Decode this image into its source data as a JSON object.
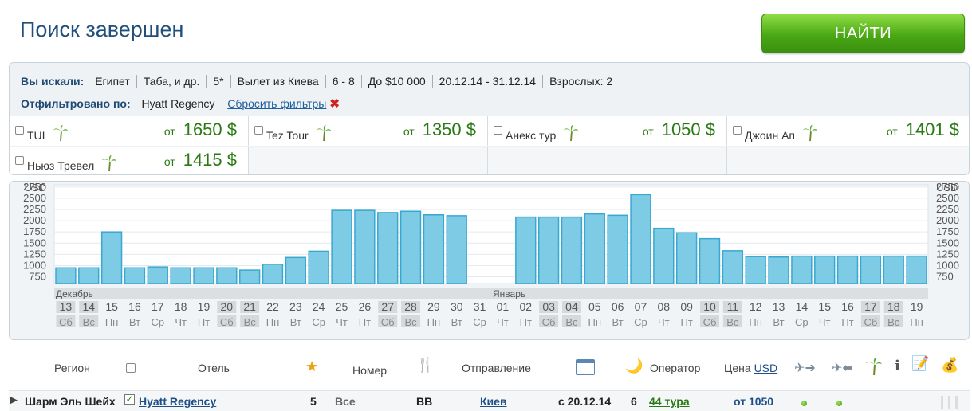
{
  "page_title": "Поиск завершен",
  "find_button": "НАЙТИ",
  "search": {
    "label": "Вы искали:",
    "criteria": [
      "Египет",
      "Таба, и др.",
      "5*",
      "Вылет из Киева",
      "6 - 8",
      "До $10 000",
      "20.12.14 - 31.12.14",
      "Взрослых: 2"
    ],
    "filter_label": "Отфильтровано по:",
    "filter_value": "Hyatt Regency",
    "reset_label": "Сбросить фильтры",
    "reset_icon": "✖"
  },
  "operators": [
    {
      "name": "TUI",
      "from": "от",
      "price": "1650 $"
    },
    {
      "name": "Tez Tour",
      "from": "от",
      "price": "1350 $"
    },
    {
      "name": "Анекс тур",
      "from": "от",
      "price": "1050 $"
    },
    {
      "name": "Джоин Ап",
      "from": "от",
      "price": "1401 $"
    },
    {
      "name": "Ньюз Тревел",
      "from": "от",
      "price": "1415 $"
    }
  ],
  "chart_data": {
    "type": "bar",
    "y_unit": "USD",
    "y_ticks": [
      750,
      1000,
      1250,
      1500,
      1750,
      2000,
      2250,
      2500,
      2750
    ],
    "ylim": [
      600,
      2800
    ],
    "months": [
      {
        "label": "Декабрь",
        "start_index": 0
      },
      {
        "label": "Январь",
        "start_index": 19
      }
    ],
    "days": [
      "13",
      "14",
      "15",
      "16",
      "17",
      "18",
      "19",
      "20",
      "21",
      "22",
      "23",
      "24",
      "25",
      "26",
      "27",
      "28",
      "29",
      "30",
      "31",
      "01",
      "02",
      "03",
      "04",
      "05",
      "06",
      "07",
      "08",
      "09",
      "10",
      "11",
      "12",
      "13",
      "14",
      "15",
      "16",
      "17",
      "18",
      "19"
    ],
    "weekdays": [
      "Сб",
      "Вс",
      "Пн",
      "Вт",
      "Ср",
      "Чт",
      "Пт",
      "Сб",
      "Вс",
      "Пн",
      "Вт",
      "Ср",
      "Чт",
      "Пт",
      "Сб",
      "Вс",
      "Пн",
      "Вт",
      "Ср",
      "Чт",
      "Пт",
      "Сб",
      "Вс",
      "Пн",
      "Вт",
      "Ср",
      "Чт",
      "Пт",
      "Сб",
      "Вс",
      "Пн",
      "Вт",
      "Ср",
      "Чт",
      "Пт",
      "Сб",
      "Вс",
      "Пн"
    ],
    "weekend": [
      true,
      true,
      false,
      false,
      false,
      false,
      false,
      true,
      true,
      false,
      false,
      false,
      false,
      false,
      true,
      true,
      false,
      false,
      false,
      false,
      false,
      true,
      true,
      false,
      false,
      false,
      false,
      false,
      true,
      true,
      false,
      false,
      false,
      false,
      false,
      true,
      true,
      false
    ],
    "values": [
      950,
      950,
      1750,
      950,
      970,
      950,
      950,
      950,
      900,
      1030,
      1180,
      1320,
      2230,
      2230,
      2180,
      2210,
      2130,
      2110,
      null,
      null,
      2080,
      2080,
      2080,
      2150,
      2120,
      2580,
      1830,
      1730,
      1600,
      1330,
      1200,
      1190,
      1210,
      1210,
      1210,
      1210,
      1210,
      1210
    ]
  },
  "columns": {
    "region": "Регион",
    "hotel": "Отель",
    "room": "Номер",
    "departure": "Отправление",
    "operator": "Оператор",
    "price": "Цена",
    "currency": "USD"
  },
  "result_row": {
    "region": "Шарм Эль Шейх",
    "hotel": "Hyatt Regency",
    "stars": "5",
    "room": "Все",
    "meal": "BB",
    "city": "Киев",
    "date": "с 20.12.14",
    "nights": "6",
    "tours": "44 тура",
    "price": "от 1050"
  },
  "colors": {
    "bar": "#7ecbe6",
    "bar_border": "#3aa7cf",
    "price": "#2a7a14",
    "title": "#1f4f7a"
  }
}
